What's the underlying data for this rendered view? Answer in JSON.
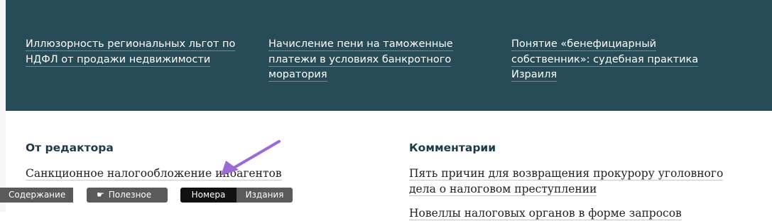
{
  "top_articles": [
    {
      "label": "Иллюзорность региональных льгот по НДФЛ от продажи недвижимости"
    },
    {
      "label": "Начисление пени на таможенные платежи в условиях банкротного моратория"
    },
    {
      "label": "Понятие «бенефициарный собственник»: судебная практика Израиля"
    }
  ],
  "editor": {
    "title": "От редактора",
    "items": [
      "Санкционное налогообложение иноагентов"
    ]
  },
  "comments": {
    "title": "Комментарии",
    "items": [
      "Пять причин для возвращения прокурору уголовного дела о налоговом преступлении",
      "Новеллы налоговых органов в форме запросов"
    ]
  },
  "toolbar": {
    "contents_label": "Содержание",
    "useful_label": "Полезное",
    "useful_icon": "pointing-hand-icon",
    "issues_label": "Номера",
    "editions_label": "Издания"
  },
  "annotation": {
    "arrow_color": "#9b6ad6"
  }
}
